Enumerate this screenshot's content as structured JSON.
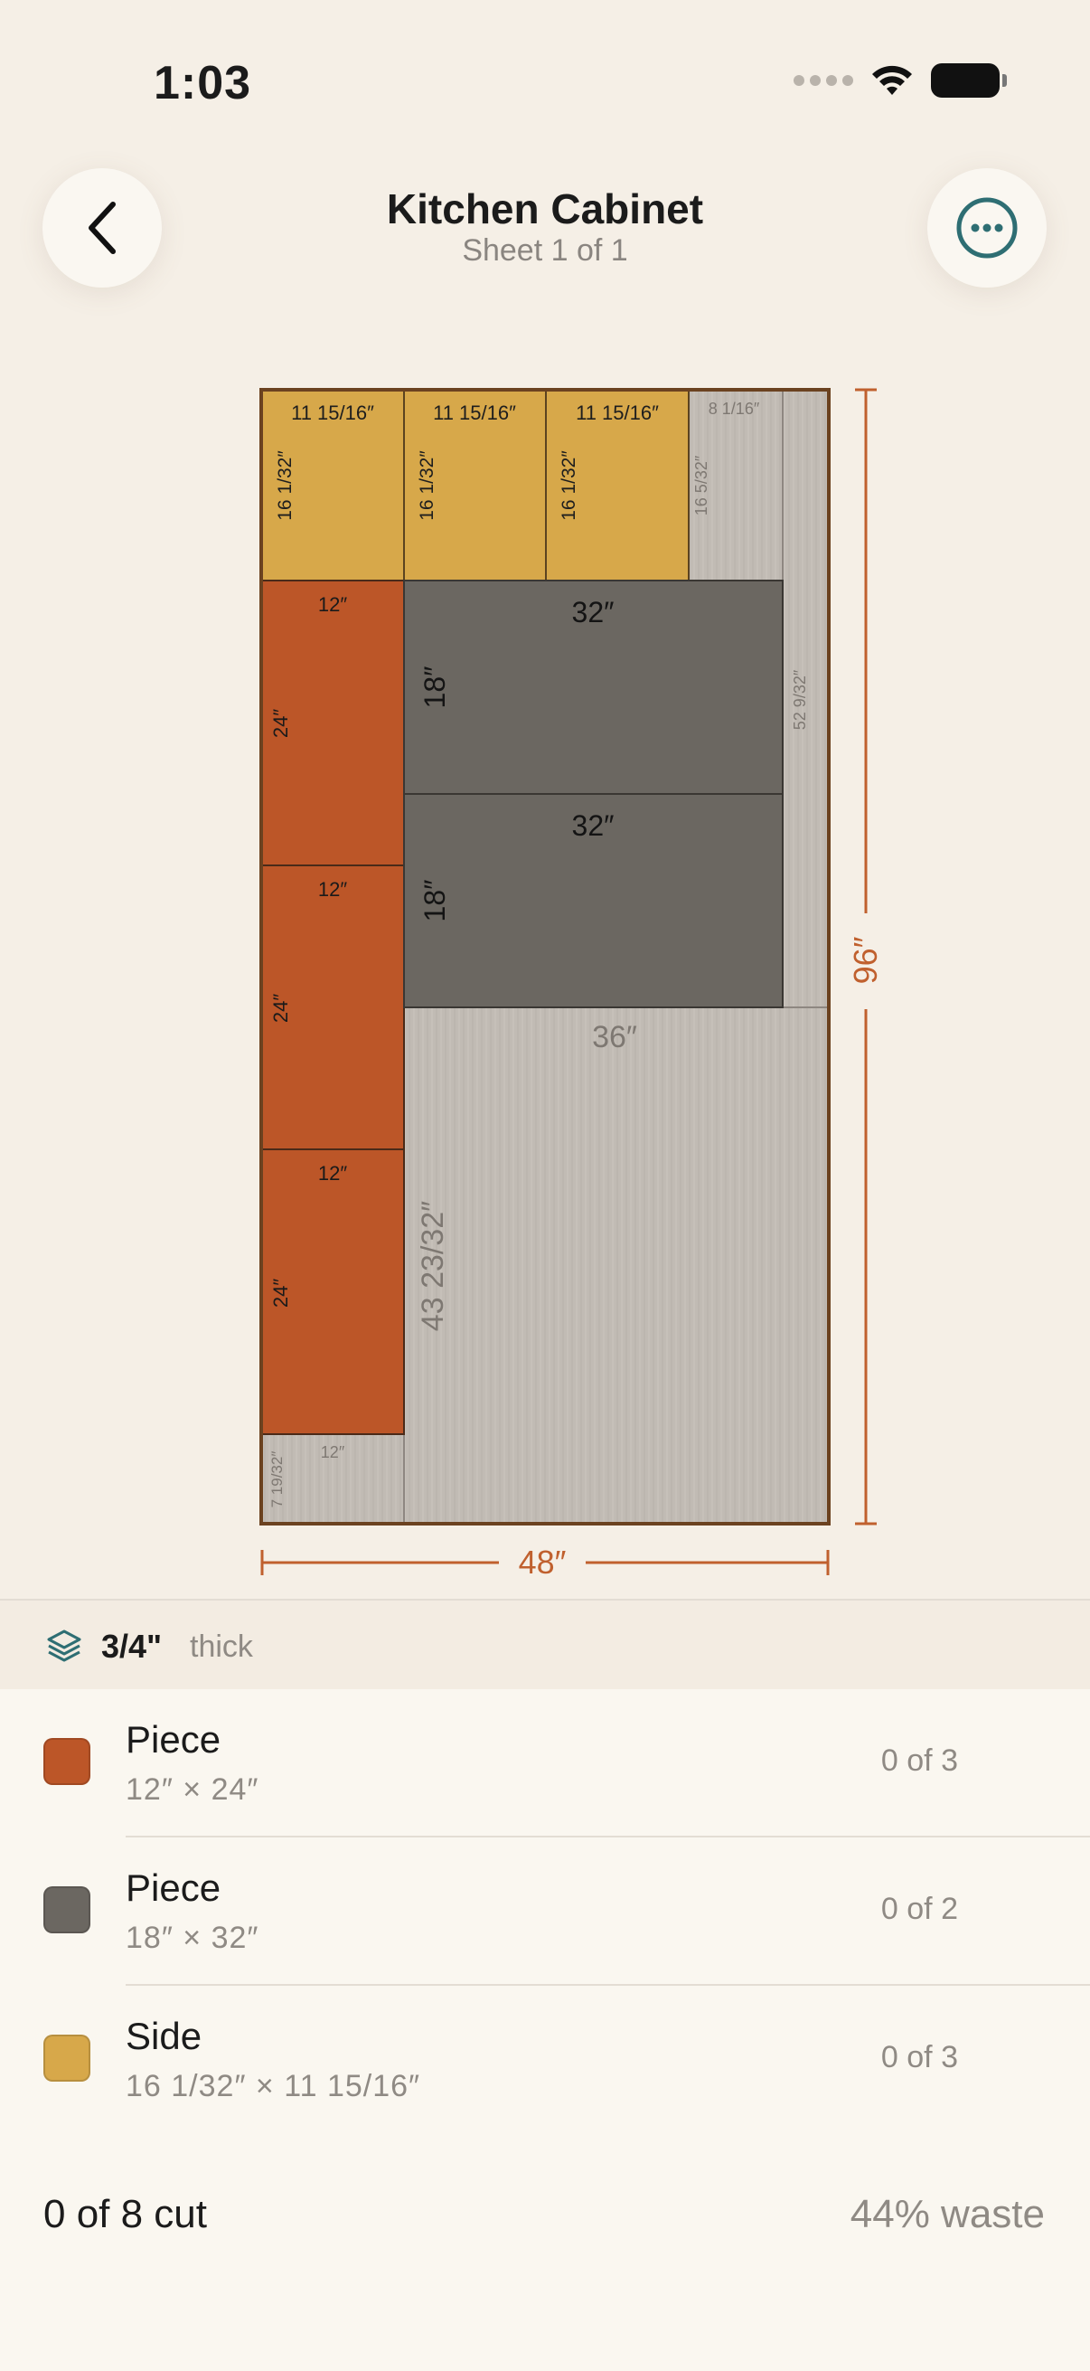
{
  "status_bar": {
    "time": "1:03"
  },
  "header": {
    "title": "Kitchen Cabinet",
    "subtitle": "Sheet 1 of 1"
  },
  "sheet": {
    "width_label": "48″",
    "height_label": "96″",
    "accent_color": "#c0602e",
    "panels": [
      {
        "id": "side-1",
        "w": "11 15/16″",
        "h": "16 1/32″",
        "color": "#d7a84a"
      },
      {
        "id": "side-2",
        "w": "11 15/16″",
        "h": "16 1/32″",
        "color": "#d7a84a"
      },
      {
        "id": "side-3",
        "w": "11 15/16″",
        "h": "16 1/32″",
        "color": "#d7a84a"
      },
      {
        "id": "piece-12x24-1",
        "w": "12″",
        "h": "24″",
        "color": "#bc5628"
      },
      {
        "id": "piece-12x24-2",
        "w": "12″",
        "h": "24″",
        "color": "#bc5628"
      },
      {
        "id": "piece-12x24-3",
        "w": "12″",
        "h": "24″",
        "color": "#bc5628"
      },
      {
        "id": "piece-18x32-1",
        "w": "32″",
        "h": "18″",
        "color": "#6b6761"
      },
      {
        "id": "piece-18x32-2",
        "w": "32″",
        "h": "18″",
        "color": "#6b6761"
      }
    ],
    "offcuts": [
      {
        "id": "offcut-top",
        "w": "8 1/16″",
        "h": "16 5/32″"
      },
      {
        "id": "offcut-right",
        "h": "52 9/32″"
      },
      {
        "id": "offcut-large",
        "w": "36″",
        "h": "43 23/32″"
      },
      {
        "id": "offcut-bottom-left",
        "w": "12″",
        "h": "7 19/32″"
      }
    ]
  },
  "material": {
    "thickness": "3/4\"",
    "thickness_label": "thick"
  },
  "pieces": [
    {
      "name": "Piece",
      "dims": "12″ × 24″",
      "count": "0 of 3",
      "color": "#bc5628"
    },
    {
      "name": "Piece",
      "dims": "18″ × 32″",
      "count": "0 of 2",
      "color": "#6b6761"
    },
    {
      "name": "Side",
      "dims": "16 1/32″ × 11 15/16″",
      "count": "0 of 3",
      "color": "#d7a84a"
    }
  ],
  "footer": {
    "cut_status": "0 of 8 cut",
    "waste": "44% waste"
  }
}
